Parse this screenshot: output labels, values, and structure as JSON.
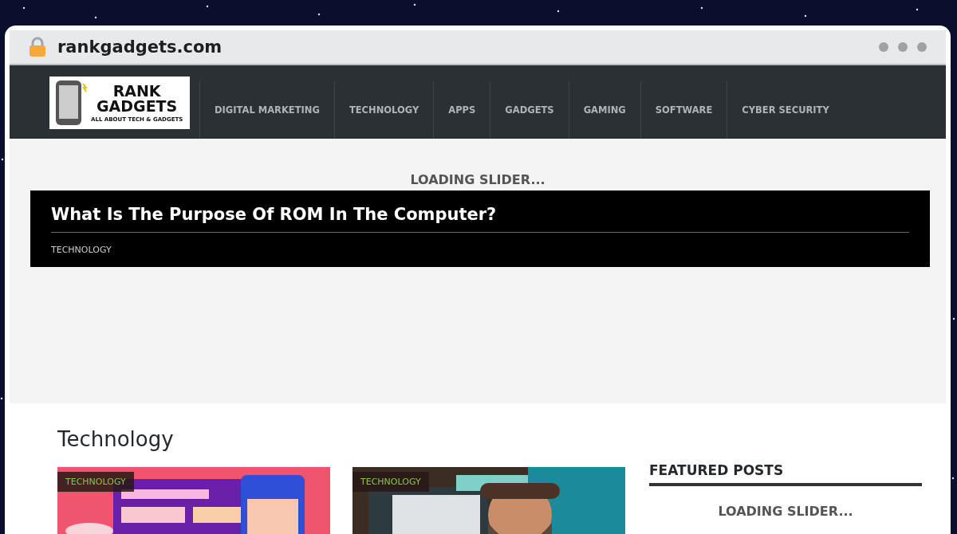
{
  "address_bar": {
    "url": "rankgadgets.com"
  },
  "nav": {
    "logo": {
      "name": "RANK",
      "name2": "GADGETS",
      "tagline": "ALL ABOUT TECH & GADGETS"
    },
    "items": [
      {
        "label": "DIGITAL MARKETING"
      },
      {
        "label": "TECHNOLOGY"
      },
      {
        "label": "APPS"
      },
      {
        "label": "GADGETS"
      },
      {
        "label": "GAMING"
      },
      {
        "label": "SOFTWARE"
      },
      {
        "label": "CYBER SECURITY"
      }
    ]
  },
  "slider": {
    "loading": "LOADING SLIDER...",
    "title": "What Is The Purpose Of ROM In The Computer?",
    "category": "TECHNOLOGY"
  },
  "section": {
    "title": "Technology",
    "cards": [
      {
        "category": "TECHNOLOGY",
        "kind": "picture"
      },
      {
        "category": "TECHNOLOGY",
        "kind": "picture"
      }
    ]
  },
  "sidebar": {
    "title": "FEATURED POSTS",
    "loading": "LOADING SLIDER..."
  }
}
